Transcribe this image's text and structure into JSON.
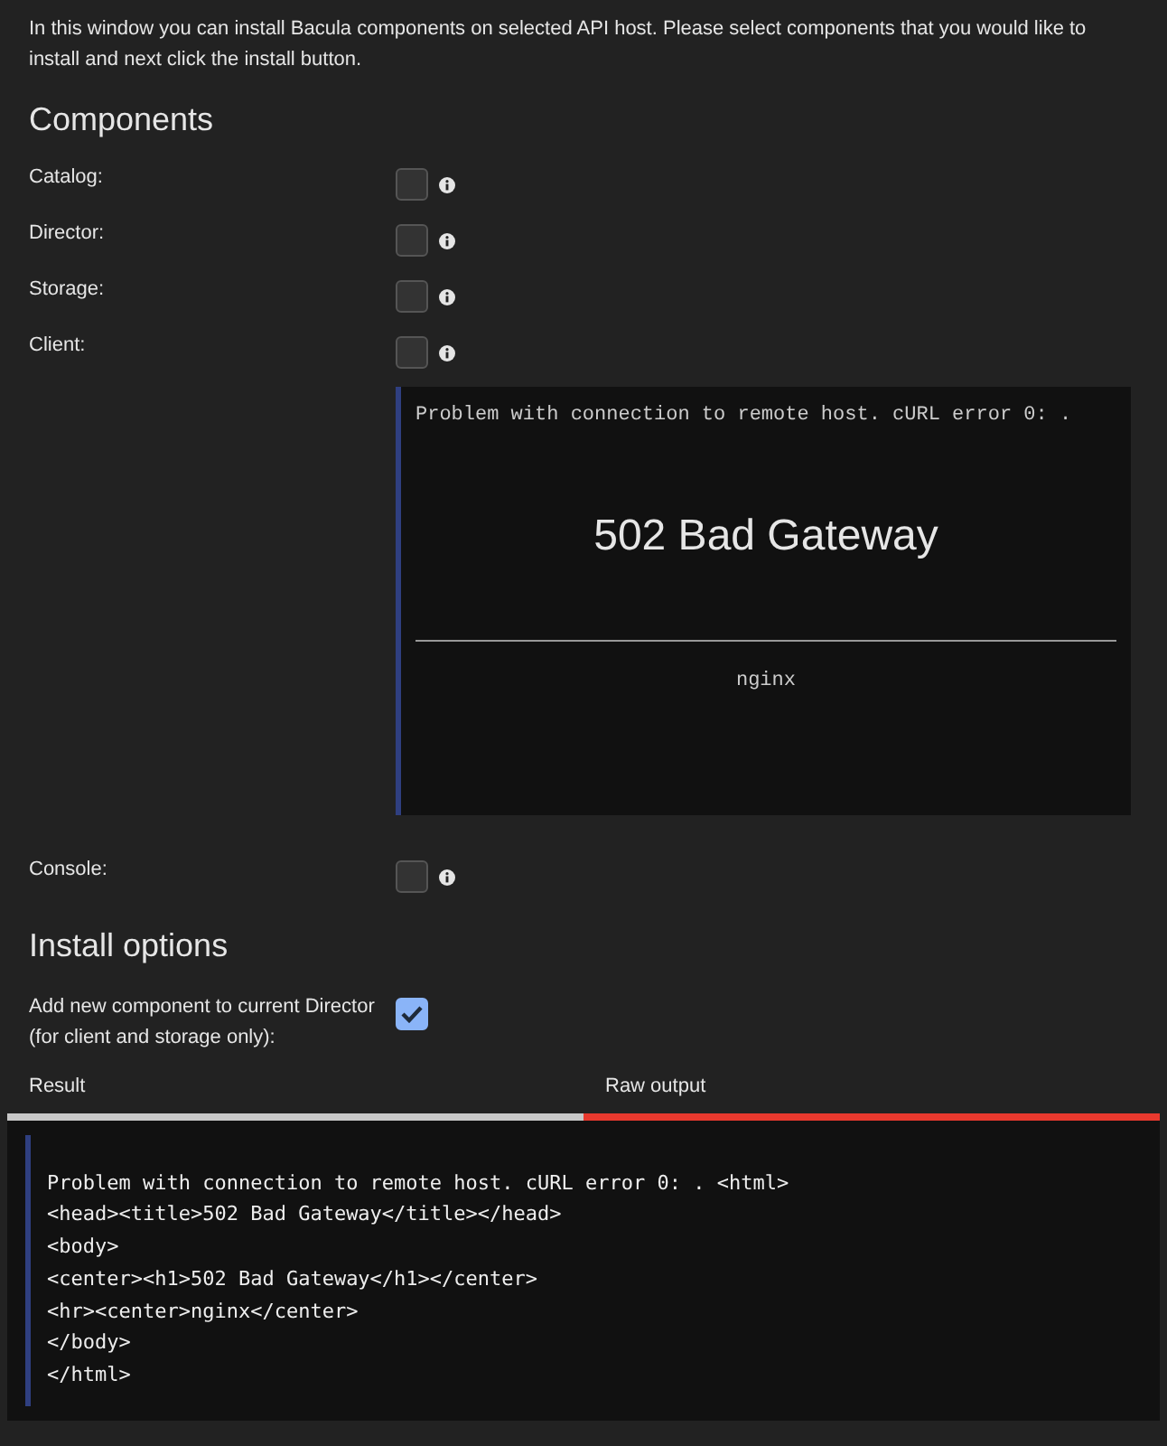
{
  "intro": "In this window you can install Bacula components on selected API host. Please select components that you would like to install and next click the install button.",
  "components_heading": "Components",
  "components": [
    {
      "label": "Catalog:",
      "checked": false
    },
    {
      "label": "Director:",
      "checked": false
    },
    {
      "label": "Storage:",
      "checked": false
    },
    {
      "label": "Client:",
      "checked": false,
      "error": {
        "message": "Problem with connection to remote host. cURL error 0: .",
        "heading": "502 Bad Gateway",
        "footer": "nginx"
      }
    },
    {
      "label": "Console:",
      "checked": false
    }
  ],
  "options_heading": "Install options",
  "options": [
    {
      "label": "Add new component to current Director (for client and storage only):",
      "checked": true
    }
  ],
  "tabs": [
    {
      "label": "Result",
      "selected": false
    },
    {
      "label": "Raw output",
      "selected": true
    }
  ],
  "raw_output": [
    "Problem with connection to remote host. cURL error 0: . <html>",
    "<head><title>502 Bad Gateway</title></head>",
    "<body>",
    "<center><h1>502 Bad Gateway</h1></center>",
    "<hr><center>nginx</center>",
    "</body>",
    "</html>"
  ]
}
